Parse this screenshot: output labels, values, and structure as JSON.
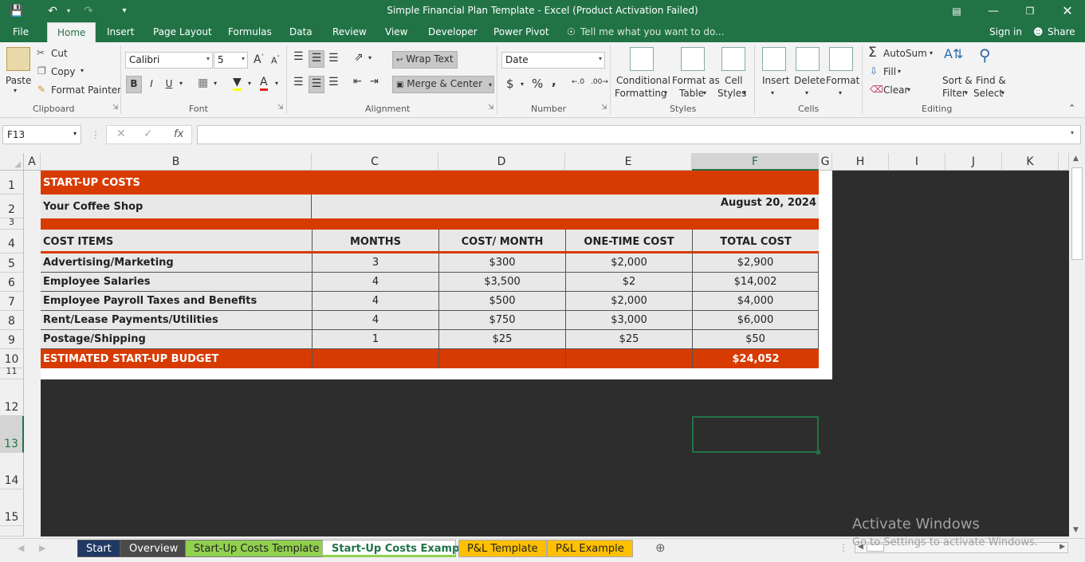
{
  "window": {
    "title": "Simple Financial Plan Template - Excel (Product Activation Failed)"
  },
  "menu": {
    "file": "File",
    "tabs": [
      "Home",
      "Insert",
      "Page Layout",
      "Formulas",
      "Data",
      "Review",
      "View",
      "Developer",
      "Power Pivot"
    ],
    "tell_me": "Tell me what you want to do...",
    "sign_in": "Sign in",
    "share": "Share"
  },
  "ribbon": {
    "clipboard": {
      "paste": "Paste",
      "cut": "Cut",
      "copy": "Copy",
      "format_painter": "Format Painter",
      "label": "Clipboard"
    },
    "font": {
      "name": "Calibri",
      "size": "5",
      "bold": "B",
      "italic": "I",
      "underline": "U",
      "label": "Font"
    },
    "alignment": {
      "wrap_text": "Wrap Text",
      "merge_center": "Merge & Center",
      "label": "Alignment"
    },
    "number": {
      "format": "Date",
      "currency": "$",
      "percent": "%",
      "comma": ",",
      "label": "Number"
    },
    "styles": {
      "conditional": "Conditional",
      "conditional2": "Formatting",
      "format_as": "Format as",
      "format_as2": "Table",
      "cell": "Cell",
      "cell2": "Styles",
      "label": "Styles"
    },
    "cells": {
      "insert": "Insert",
      "delete": "Delete",
      "format": "Format",
      "label": "Cells"
    },
    "editing": {
      "autosum": "AutoSum",
      "fill": "Fill",
      "clear": "Clear",
      "sort": "Sort &",
      "sort2": "Filter",
      "find": "Find &",
      "find2": "Select",
      "label": "Editing"
    }
  },
  "formula_bar": {
    "name_box": "F13",
    "fx": "fx",
    "value": ""
  },
  "columns": [
    "A",
    "B",
    "C",
    "D",
    "E",
    "F",
    "G",
    "H",
    "I",
    "J",
    "K"
  ],
  "rows": [
    "1",
    "2",
    "3",
    "4",
    "5",
    "6",
    "7",
    "8",
    "9",
    "10",
    "11",
    "12",
    "13",
    "14",
    "15"
  ],
  "sheet": {
    "title": "START-UP COSTS",
    "company": "Your Coffee Shop",
    "date": "August 20, 2024",
    "headers": [
      "COST ITEMS",
      "MONTHS",
      "COST/ MONTH",
      "ONE-TIME COST",
      "TOTAL COST"
    ],
    "items": [
      {
        "name": "Advertising/Marketing",
        "months": "3",
        "cost_month": "$300",
        "one_time": "$2,000",
        "total": "$2,900"
      },
      {
        "name": "Employee Salaries",
        "months": "4",
        "cost_month": "$3,500",
        "one_time": "$2",
        "total": "$14,002"
      },
      {
        "name": "Employee Payroll Taxes and Benefits",
        "months": "4",
        "cost_month": "$500",
        "one_time": "$2,000",
        "total": "$4,000"
      },
      {
        "name": "Rent/Lease Payments/Utilities",
        "months": "4",
        "cost_month": "$750",
        "one_time": "$3,000",
        "total": "$6,000"
      },
      {
        "name": "Postage/Shipping",
        "months": "1",
        "cost_month": "$25",
        "one_time": "$25",
        "total": "$50"
      }
    ],
    "budget_label": "ESTIMATED START-UP BUDGET",
    "budget_total": "$24,052"
  },
  "sheet_tabs": [
    {
      "label": "Start",
      "color": "#203864"
    },
    {
      "label": "Overview",
      "color": "#4a4a4a"
    },
    {
      "label": "Start-Up Costs Template",
      "color": "#92d050"
    },
    {
      "label": "Start-Up Costs Example",
      "color": "#ffffff"
    },
    {
      "label": "P&L Template",
      "color": "#ffc000"
    },
    {
      "label": "P&L Example",
      "color": "#ffc000"
    }
  ],
  "watermark": {
    "line1": "Activate Windows",
    "line2": "Go to Settings to activate Windows."
  }
}
